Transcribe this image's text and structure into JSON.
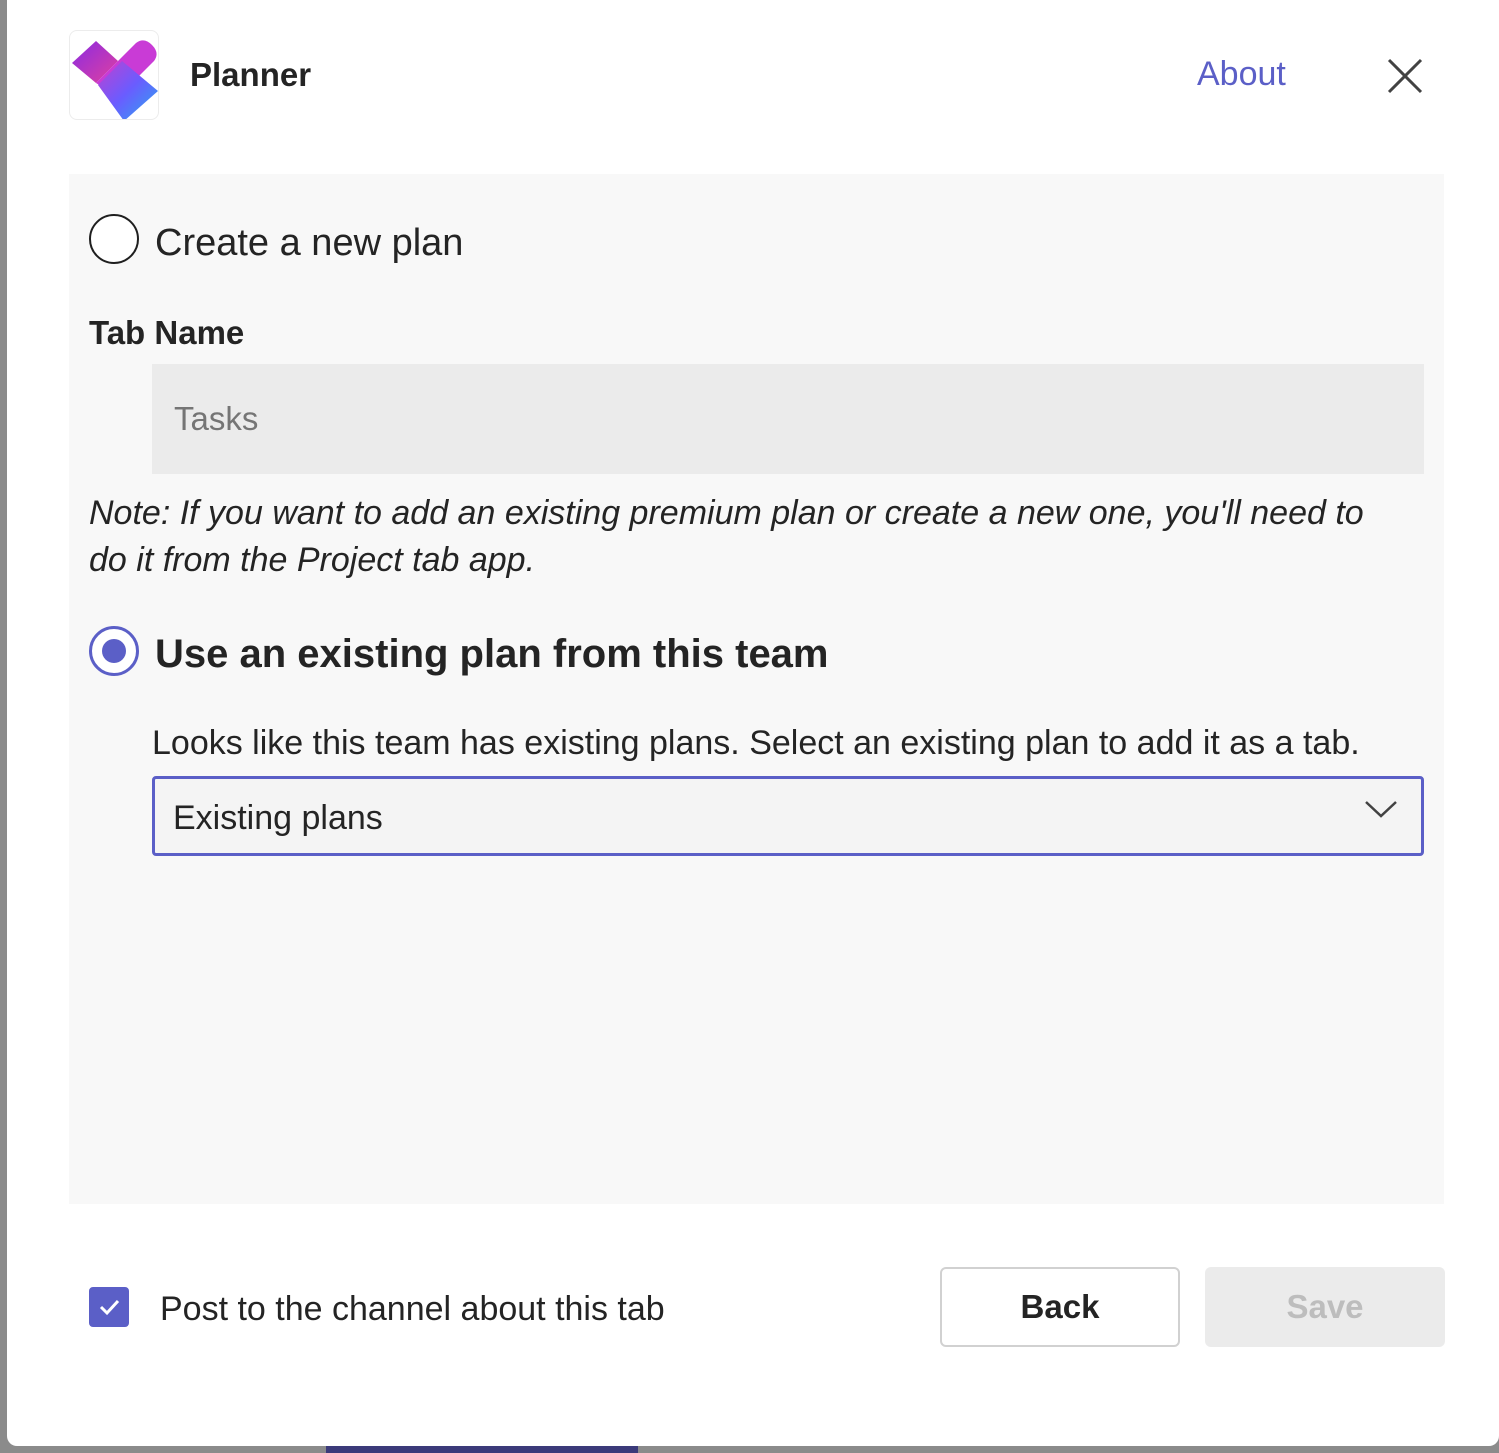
{
  "header": {
    "app_name": "Planner",
    "about_label": "About",
    "logo_icon": "planner-logo-icon",
    "close_icon": "close-icon"
  },
  "options": {
    "create_new_label": "Create a new plan",
    "create_new_selected": false,
    "tab_name_label": "Tab Name",
    "tab_name_placeholder": "Tasks",
    "note": "Note: If you want to add an existing premium plan or create a new one, you'll need to do it from the Project tab app.",
    "use_existing_label": "Use an existing plan from this team",
    "use_existing_selected": true,
    "existing_hint": "Looks like this team has existing plans. Select an existing plan to add it as a tab.",
    "existing_select_value": "Existing plans"
  },
  "footer": {
    "post_to_channel_label": "Post to the channel about this tab",
    "post_to_channel_checked": true,
    "back_label": "Back",
    "save_label": "Save"
  },
  "colors": {
    "accent": "#5b5fc7",
    "panel_bg": "#f8f8f8",
    "disabled_bg": "#ebebeb"
  }
}
